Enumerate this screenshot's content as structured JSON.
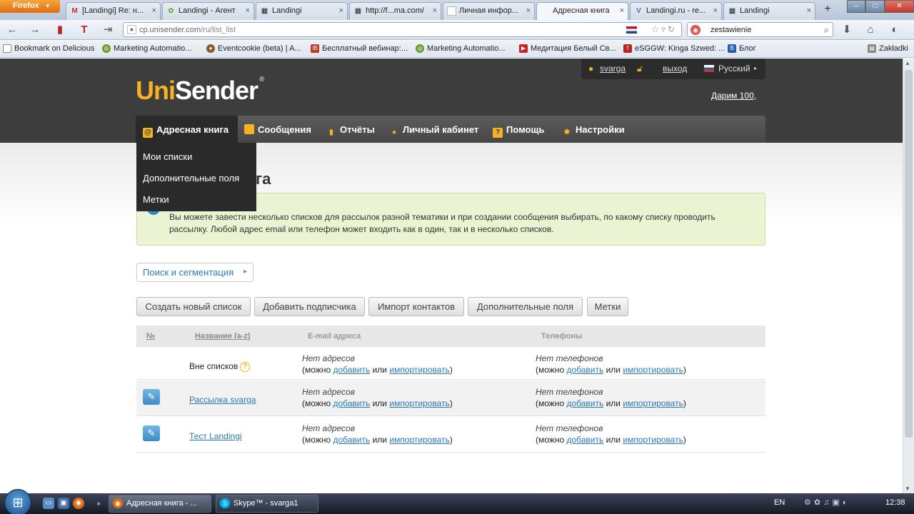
{
  "browser": {
    "app_button": "Firefox",
    "tabs": [
      {
        "label": "[Landingi] Re: н...",
        "icon": "gmail-icon"
      },
      {
        "label": "Landingi - Агент",
        "icon": "gear-icon"
      },
      {
        "label": "Landingi",
        "icon": "grid-icon"
      },
      {
        "label": "http://f...ma.com/",
        "icon": "grid-icon"
      },
      {
        "label": "Личная инфор...",
        "icon": "page-icon"
      },
      {
        "label": "Адресная книга",
        "icon": "page-icon",
        "active": true
      },
      {
        "label": "Landingi.ru - re...",
        "icon": "vk-icon"
      },
      {
        "label": "Landingi",
        "icon": "grid-icon"
      }
    ],
    "url_host": "cp.unisender.com",
    "url_path": "/ru/list_list",
    "search_query": "zestawienie",
    "bookmarks": [
      "Bookmark on Delicious",
      "Marketing Automatio...",
      "Eventcookie (beta) | A...",
      "Бесплатный вебинар:...",
      "Marketing Automatio...",
      "Медитация Белый Св...",
      "eSGGW: Kinga Szwed: ...",
      "Блог"
    ],
    "bookmarks_folder": "Zakładki"
  },
  "site": {
    "logo_uni": "Uni",
    "logo_sender": "Sender",
    "logo_reg": "®",
    "user_name": "svarga",
    "logout": "выход",
    "language": "Русский",
    "promo": "Дарим 100,",
    "nav": [
      {
        "label": "Адресная книга",
        "icon": "address-book-icon",
        "active": true
      },
      {
        "label": "Сообщения",
        "icon": "messages-icon"
      },
      {
        "label": "Отчёты",
        "icon": "reports-icon"
      },
      {
        "label": "Личный кабинет",
        "icon": "user-icon"
      },
      {
        "label": "Помощь",
        "icon": "help-icon"
      },
      {
        "label": "Настройки",
        "icon": "settings-icon"
      }
    ],
    "submenu": [
      "Мои списки",
      "Дополнительные поля",
      "Метки"
    ],
    "page_title_visible": "га",
    "info_text": "Вы можете завести несколько списков для рассылок разной тематики и при создании сообщения выбирать, по какому списку проводить рассылку. Любой адрес email или телефон может входить как в один, так и в несколько списков.",
    "search_segmentation": "Поиск и сегментация",
    "buttons": [
      "Создать новый список",
      "Добавить подписчика",
      "Импорт контактов",
      "Дополнительные поля",
      "Метки"
    ],
    "table": {
      "headers": {
        "num": "№",
        "name": "Название (а-z)",
        "email": "E-mail адреса",
        "phones": "Телефоны"
      },
      "rows": [
        {
          "name": "Вне списков",
          "editable": false,
          "email_status": "Нет адресов",
          "phone_status": "Нет телефонов"
        },
        {
          "name": "Рассылка svarga",
          "editable": true,
          "email_status": "Нет адресов",
          "phone_status": "Нет телефонов"
        },
        {
          "name": "Тест Landingi",
          "editable": true,
          "email_status": "Нет адресов",
          "phone_status": "Нет телефонов"
        }
      ],
      "hint_prefix": "(можно",
      "hint_add": "добавить",
      "hint_or": "или",
      "hint_import": "импортировать",
      "hint_suffix": ")"
    }
  },
  "taskbar": {
    "tasks": [
      {
        "label": "Адресная книга - ...",
        "icon": "firefox-icon",
        "active": true
      },
      {
        "label": "Skype™ - svarga1",
        "icon": "skype-icon"
      }
    ],
    "lang": "EN",
    "clock": "12:38"
  }
}
